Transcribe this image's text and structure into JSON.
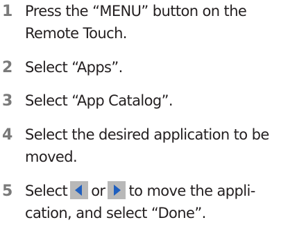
{
  "steps": [
    {
      "number": "1",
      "lines": [
        "Press the “MENU” button on the",
        "Remote Touch."
      ]
    },
    {
      "number": "2",
      "lines": [
        "Select “Apps”."
      ]
    },
    {
      "number": "3",
      "lines": [
        "Select “App Catalog”."
      ]
    },
    {
      "number": "4",
      "lines": [
        "Select the desired application to be",
        "moved."
      ]
    },
    {
      "number": "5",
      "line1": {
        "before": "Select",
        "between": "or",
        "after": "to move the appli-"
      },
      "line2": "cation, and select “Done”."
    }
  ],
  "icons": {
    "left_button": "left-arrow-button-icon",
    "right_button": "right-arrow-button-icon"
  },
  "colors": {
    "step_number": "#7a7a7a",
    "button_background": "#b8b8b8",
    "arrow_fill": "#1f5fbf"
  }
}
